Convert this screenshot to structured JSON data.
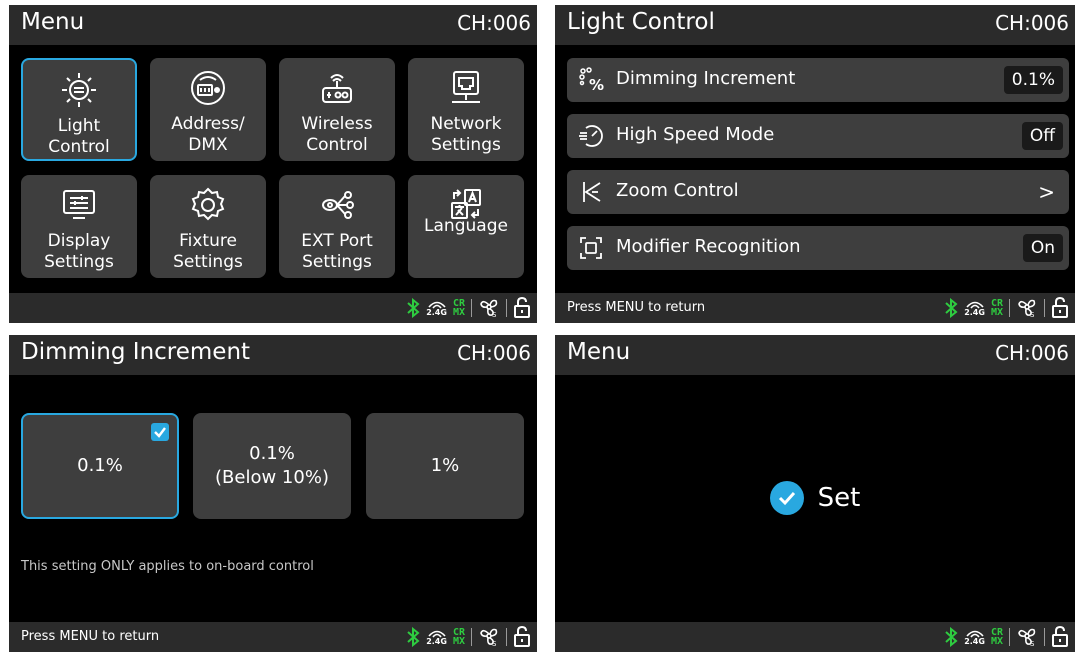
{
  "status_bar": {
    "icons": [
      "bluetooth-icon",
      "wireless-2.4g-icon",
      "crmx-icon",
      "fan-icon",
      "unlock-icon"
    ],
    "label_24g": "2.4G",
    "crmx_top": "CR",
    "crmx_bottom": "MX",
    "colors": {
      "bluetooth": "#2ecc40",
      "crmx": "#2ecc40"
    }
  },
  "screen_menu": {
    "title": "Menu",
    "channel": "CH:006",
    "tiles": [
      {
        "label": "Light\nControl",
        "icon": "light-icon",
        "selected": true
      },
      {
        "label": "Address/\nDMX",
        "icon": "address-dmx-icon",
        "selected": false
      },
      {
        "label": "Wireless\nControl",
        "icon": "wireless-icon",
        "selected": false
      },
      {
        "label": "Network\nSettings",
        "icon": "network-icon",
        "selected": false
      },
      {
        "label": "Display\nSettings",
        "icon": "display-icon",
        "selected": false
      },
      {
        "label": "Fixture\nSettings",
        "icon": "gear-icon",
        "selected": false
      },
      {
        "label": "EXT Port\nSettings",
        "icon": "ext-port-icon",
        "selected": false
      },
      {
        "label": "Language",
        "icon": "language-icon",
        "selected": false
      }
    ]
  },
  "screen_light_control": {
    "title": "Light Control",
    "channel": "CH:006",
    "rows": [
      {
        "label": "Dimming Increment",
        "value": "0.1%",
        "icon": "dimming-icon"
      },
      {
        "label": "High Speed Mode",
        "value": "Off",
        "icon": "speed-icon"
      },
      {
        "label": "Zoom Control",
        "value": ">",
        "icon": "zoom-icon"
      },
      {
        "label": "Modifier Recognition",
        "value": "On",
        "icon": "modifier-icon"
      }
    ],
    "footer": "Press MENU to return"
  },
  "screen_dimming": {
    "title": "Dimming Increment",
    "channel": "CH:006",
    "options": [
      {
        "label": "0.1%",
        "selected": true
      },
      {
        "label": "0.1%\n(Below 10%)",
        "selected": false
      },
      {
        "label": "1%",
        "selected": false
      }
    ],
    "note": "This setting ONLY applies to on-board control",
    "footer": "Press MENU to return"
  },
  "screen_set": {
    "title": "Menu",
    "channel": "CH:006",
    "message": "Set",
    "accent": "#29a8e0"
  }
}
